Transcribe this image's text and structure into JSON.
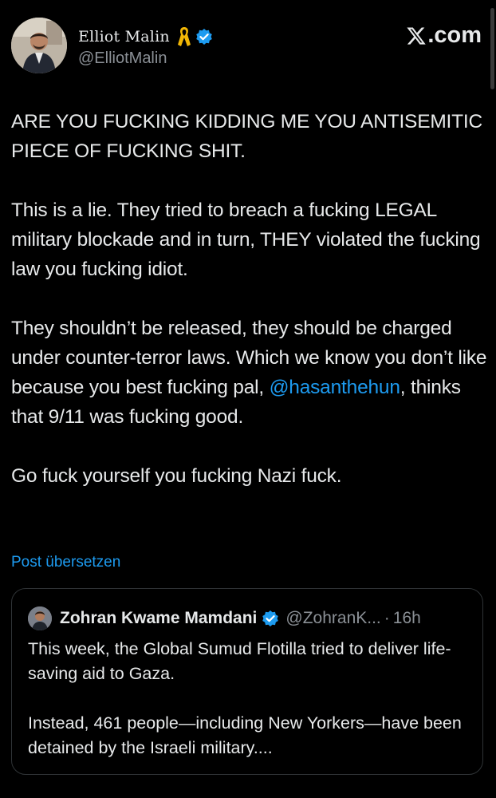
{
  "author": {
    "name": "Elliot Malin",
    "handle": "@ElliotMalin"
  },
  "brand": {
    "label": ".com"
  },
  "tweet": {
    "paragraph_1": "ARE YOU FUCKING KIDDING ME YOU ANTISEMITIC PIECE OF FUCKING SHIT.",
    "paragraph_2": "This is a lie. They tried to breach a fucking LEGAL military blockade and in turn, THEY violated the fucking law you fucking idiot.",
    "paragraph_3_before": "They shouldn’t be released, they should be charged under counter-terror laws. Which we know you don’t like because you best fucking pal, ",
    "mention": "@hasanthehun",
    "paragraph_3_after": ", thinks that 9/11 was fucking good.",
    "paragraph_4": "Go fuck yourself you fucking Nazi fuck.",
    "translate_label": "Post übersetzen"
  },
  "quote": {
    "author_name": "Zohran Kwame Mamdani",
    "handle": "@ZohranK...",
    "separator": "·",
    "time": "16h",
    "paragraph_1": "This week, the Global Sumud Flotilla tried to deliver life-saving aid to Gaza.",
    "paragraph_2": "Instead, 461 people—including New Yorkers—have been detained by the Israeli military...."
  },
  "colors": {
    "background": "#000000",
    "text": "#e7e9ea",
    "secondary_text": "#8b9096",
    "link": "#1d9bf0",
    "verified": "#1d9bf0",
    "ribbon": "#f2b705",
    "card_border": "#2f3336"
  },
  "icons": {
    "ribbon": "yellow-ribbon-icon",
    "verified": "verified-badge-icon",
    "x_logo": "x-logo-icon"
  }
}
